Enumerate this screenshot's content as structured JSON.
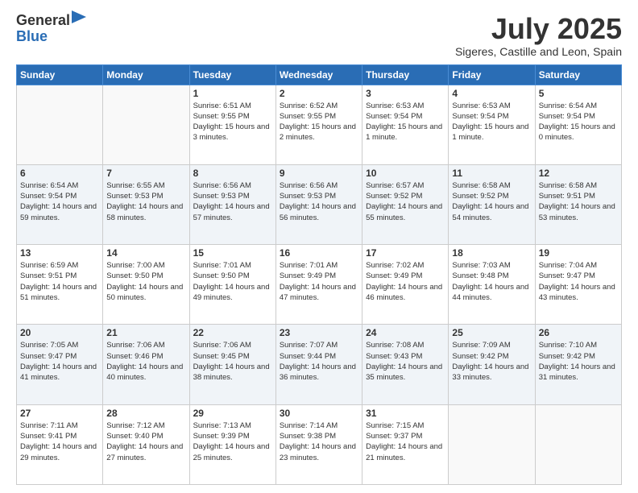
{
  "logo": {
    "general": "General",
    "blue": "Blue"
  },
  "title": "July 2025",
  "subtitle": "Sigeres, Castille and Leon, Spain",
  "days_of_week": [
    "Sunday",
    "Monday",
    "Tuesday",
    "Wednesday",
    "Thursday",
    "Friday",
    "Saturday"
  ],
  "weeks": [
    [
      {
        "day": "",
        "content": ""
      },
      {
        "day": "",
        "content": ""
      },
      {
        "day": "1",
        "content": "Sunrise: 6:51 AM\nSunset: 9:55 PM\nDaylight: 15 hours and 3 minutes."
      },
      {
        "day": "2",
        "content": "Sunrise: 6:52 AM\nSunset: 9:55 PM\nDaylight: 15 hours and 2 minutes."
      },
      {
        "day": "3",
        "content": "Sunrise: 6:53 AM\nSunset: 9:54 PM\nDaylight: 15 hours and 1 minute."
      },
      {
        "day": "4",
        "content": "Sunrise: 6:53 AM\nSunset: 9:54 PM\nDaylight: 15 hours and 1 minute."
      },
      {
        "day": "5",
        "content": "Sunrise: 6:54 AM\nSunset: 9:54 PM\nDaylight: 15 hours and 0 minutes."
      }
    ],
    [
      {
        "day": "6",
        "content": "Sunrise: 6:54 AM\nSunset: 9:54 PM\nDaylight: 14 hours and 59 minutes."
      },
      {
        "day": "7",
        "content": "Sunrise: 6:55 AM\nSunset: 9:53 PM\nDaylight: 14 hours and 58 minutes."
      },
      {
        "day": "8",
        "content": "Sunrise: 6:56 AM\nSunset: 9:53 PM\nDaylight: 14 hours and 57 minutes."
      },
      {
        "day": "9",
        "content": "Sunrise: 6:56 AM\nSunset: 9:53 PM\nDaylight: 14 hours and 56 minutes."
      },
      {
        "day": "10",
        "content": "Sunrise: 6:57 AM\nSunset: 9:52 PM\nDaylight: 14 hours and 55 minutes."
      },
      {
        "day": "11",
        "content": "Sunrise: 6:58 AM\nSunset: 9:52 PM\nDaylight: 14 hours and 54 minutes."
      },
      {
        "day": "12",
        "content": "Sunrise: 6:58 AM\nSunset: 9:51 PM\nDaylight: 14 hours and 53 minutes."
      }
    ],
    [
      {
        "day": "13",
        "content": "Sunrise: 6:59 AM\nSunset: 9:51 PM\nDaylight: 14 hours and 51 minutes."
      },
      {
        "day": "14",
        "content": "Sunrise: 7:00 AM\nSunset: 9:50 PM\nDaylight: 14 hours and 50 minutes."
      },
      {
        "day": "15",
        "content": "Sunrise: 7:01 AM\nSunset: 9:50 PM\nDaylight: 14 hours and 49 minutes."
      },
      {
        "day": "16",
        "content": "Sunrise: 7:01 AM\nSunset: 9:49 PM\nDaylight: 14 hours and 47 minutes."
      },
      {
        "day": "17",
        "content": "Sunrise: 7:02 AM\nSunset: 9:49 PM\nDaylight: 14 hours and 46 minutes."
      },
      {
        "day": "18",
        "content": "Sunrise: 7:03 AM\nSunset: 9:48 PM\nDaylight: 14 hours and 44 minutes."
      },
      {
        "day": "19",
        "content": "Sunrise: 7:04 AM\nSunset: 9:47 PM\nDaylight: 14 hours and 43 minutes."
      }
    ],
    [
      {
        "day": "20",
        "content": "Sunrise: 7:05 AM\nSunset: 9:47 PM\nDaylight: 14 hours and 41 minutes."
      },
      {
        "day": "21",
        "content": "Sunrise: 7:06 AM\nSunset: 9:46 PM\nDaylight: 14 hours and 40 minutes."
      },
      {
        "day": "22",
        "content": "Sunrise: 7:06 AM\nSunset: 9:45 PM\nDaylight: 14 hours and 38 minutes."
      },
      {
        "day": "23",
        "content": "Sunrise: 7:07 AM\nSunset: 9:44 PM\nDaylight: 14 hours and 36 minutes."
      },
      {
        "day": "24",
        "content": "Sunrise: 7:08 AM\nSunset: 9:43 PM\nDaylight: 14 hours and 35 minutes."
      },
      {
        "day": "25",
        "content": "Sunrise: 7:09 AM\nSunset: 9:42 PM\nDaylight: 14 hours and 33 minutes."
      },
      {
        "day": "26",
        "content": "Sunrise: 7:10 AM\nSunset: 9:42 PM\nDaylight: 14 hours and 31 minutes."
      }
    ],
    [
      {
        "day": "27",
        "content": "Sunrise: 7:11 AM\nSunset: 9:41 PM\nDaylight: 14 hours and 29 minutes."
      },
      {
        "day": "28",
        "content": "Sunrise: 7:12 AM\nSunset: 9:40 PM\nDaylight: 14 hours and 27 minutes."
      },
      {
        "day": "29",
        "content": "Sunrise: 7:13 AM\nSunset: 9:39 PM\nDaylight: 14 hours and 25 minutes."
      },
      {
        "day": "30",
        "content": "Sunrise: 7:14 AM\nSunset: 9:38 PM\nDaylight: 14 hours and 23 minutes."
      },
      {
        "day": "31",
        "content": "Sunrise: 7:15 AM\nSunset: 9:37 PM\nDaylight: 14 hours and 21 minutes."
      },
      {
        "day": "",
        "content": ""
      },
      {
        "day": "",
        "content": ""
      }
    ]
  ]
}
